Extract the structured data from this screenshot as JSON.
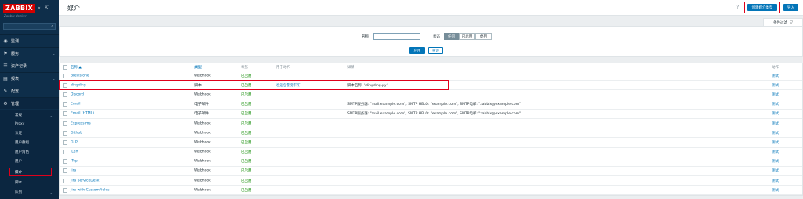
{
  "sidebar": {
    "logo": "ZABBIX",
    "subtitle": "Zabbix docker",
    "collapse_icon": "«",
    "expand_icon": "⇱",
    "menu": [
      {
        "label": "监测",
        "icon": "◉"
      },
      {
        "label": "服务",
        "icon": "⚑"
      },
      {
        "label": "资产记录",
        "icon": "☰"
      },
      {
        "label": "报表",
        "icon": "▤"
      },
      {
        "label": "配置",
        "icon": "✎"
      },
      {
        "label": "管理",
        "icon": "⚙"
      }
    ],
    "submenu": [
      {
        "label": "常规"
      },
      {
        "label": "Proxy"
      },
      {
        "label": "认证"
      },
      {
        "label": "用户群组"
      },
      {
        "label": "用户角色"
      },
      {
        "label": "用户"
      },
      {
        "label": "媒介"
      },
      {
        "label": "脚本"
      },
      {
        "label": "队列"
      }
    ]
  },
  "header": {
    "title": "媒介",
    "help": "?",
    "create_label": "创建媒介类型",
    "import_label": "导入"
  },
  "filter": {
    "tab_label": "条件过滤",
    "name_label": "名称",
    "name_value": "",
    "status_label": "状态",
    "status_options": [
      "任何",
      "已启用",
      "停用"
    ],
    "apply_label": "应用",
    "reset_label": "重设"
  },
  "table": {
    "headers": {
      "name": "名称 ▲",
      "type": "类型",
      "status": "状态",
      "used_in": "用于动作",
      "details": "详情",
      "action": "动作"
    },
    "rows": [
      {
        "name": "Brevis.one",
        "type": "Webhook",
        "status": "已启用",
        "used_in": "",
        "details": "",
        "action": "测试"
      },
      {
        "name": "dingding",
        "type": "脚本",
        "status": "已启用",
        "used_in": "发送告警到钉钉",
        "details": "脚本名称: \"dingding.py\"",
        "action": "测试"
      },
      {
        "name": "Discord",
        "type": "Webhook",
        "status": "已启用",
        "used_in": "",
        "details": "",
        "action": "测试"
      },
      {
        "name": "Email",
        "type": "电子邮件",
        "status": "已启用",
        "used_in": "",
        "details": "SMTP服务器: \"mail.example.com\", SMTP HELO: \"example.com\", SMTP电邮: \"zabbix@example.com\"",
        "action": "测试"
      },
      {
        "name": "Email (HTML)",
        "type": "电子邮件",
        "status": "已启用",
        "used_in": "",
        "details": "SMTP服务器: \"mail.example.com\", SMTP HELO: \"example.com\", SMTP电邮: \"zabbix@example.com\"",
        "action": "测试"
      },
      {
        "name": "Express.ms",
        "type": "Webhook",
        "status": "已启用",
        "used_in": "",
        "details": "",
        "action": "测试"
      },
      {
        "name": "Github",
        "type": "Webhook",
        "status": "已启用",
        "used_in": "",
        "details": "",
        "action": "测试"
      },
      {
        "name": "GLPi",
        "type": "Webhook",
        "status": "已启用",
        "used_in": "",
        "details": "",
        "action": "测试"
      },
      {
        "name": "iLert",
        "type": "Webhook",
        "status": "已启用",
        "used_in": "",
        "details": "",
        "action": "测试"
      },
      {
        "name": "iTop",
        "type": "Webhook",
        "status": "已启用",
        "used_in": "",
        "details": "",
        "action": "测试"
      },
      {
        "name": "Jira",
        "type": "Webhook",
        "status": "已启用",
        "used_in": "",
        "details": "",
        "action": "测试"
      },
      {
        "name": "Jira ServiceDesk",
        "type": "Webhook",
        "status": "已启用",
        "used_in": "",
        "details": "",
        "action": "测试"
      },
      {
        "name": "Jira with CustomFields",
        "type": "Webhook",
        "status": "已启用",
        "used_in": "",
        "details": "",
        "action": "测试"
      }
    ]
  }
}
